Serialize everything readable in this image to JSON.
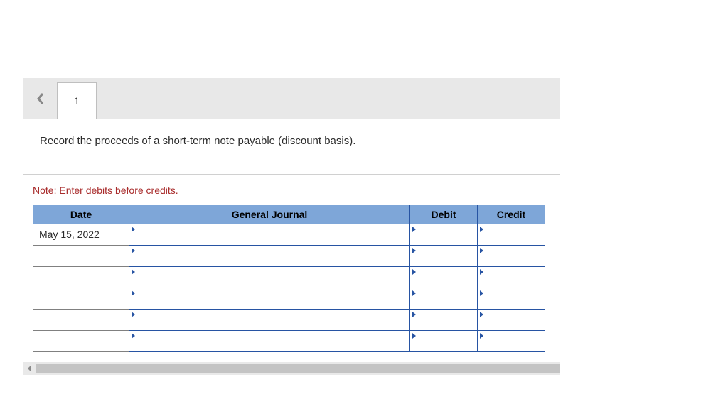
{
  "tabs": {
    "active_label": "1"
  },
  "instruction": "Record the proceeds of a short-term note payable (discount basis).",
  "note": "Note: Enter debits before credits.",
  "table": {
    "headers": {
      "date": "Date",
      "journal": "General Journal",
      "debit": "Debit",
      "credit": "Credit"
    },
    "rows": [
      {
        "date": "May 15, 2022",
        "journal": "",
        "debit": "",
        "credit": ""
      },
      {
        "date": "",
        "journal": "",
        "debit": "",
        "credit": ""
      },
      {
        "date": "",
        "journal": "",
        "debit": "",
        "credit": ""
      },
      {
        "date": "",
        "journal": "",
        "debit": "",
        "credit": ""
      },
      {
        "date": "",
        "journal": "",
        "debit": "",
        "credit": ""
      },
      {
        "date": "",
        "journal": "",
        "debit": "",
        "credit": ""
      }
    ]
  }
}
